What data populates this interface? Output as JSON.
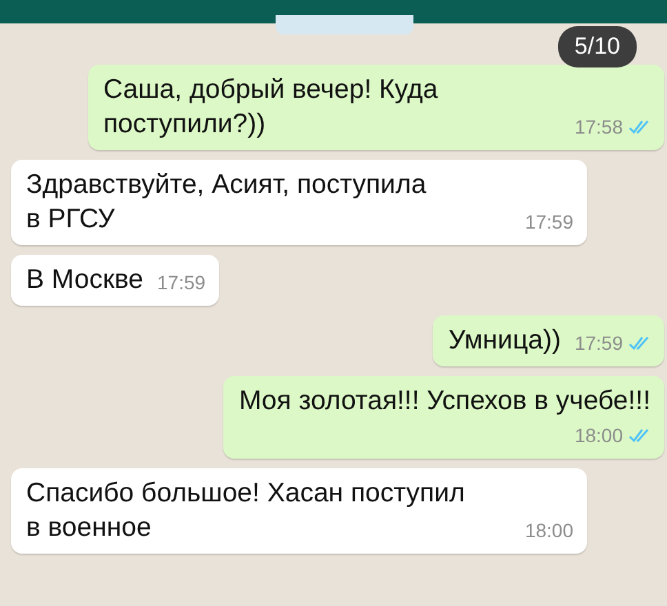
{
  "counter": "5/10",
  "messages": [
    {
      "kind": "outgoing",
      "text": "Саша, добрый вечер! Куда\nпоступили?))",
      "time": "17:58",
      "read": true
    },
    {
      "kind": "incoming",
      "text": "Здравствуйте, Асият, поступила\nв РГСУ",
      "time": "17:59"
    },
    {
      "kind": "incoming",
      "text": "В Москве",
      "time": "17:59"
    },
    {
      "kind": "outgoing",
      "text": "Умница))",
      "time": "17:59",
      "read": true
    },
    {
      "kind": "outgoing",
      "text": "Моя золотая!!! Успехов в учебе!!!",
      "time": "18:00",
      "read": true
    },
    {
      "kind": "incoming",
      "text": "Спасибо большое! Хасан поступил\nв военное",
      "time": "18:00"
    }
  ]
}
